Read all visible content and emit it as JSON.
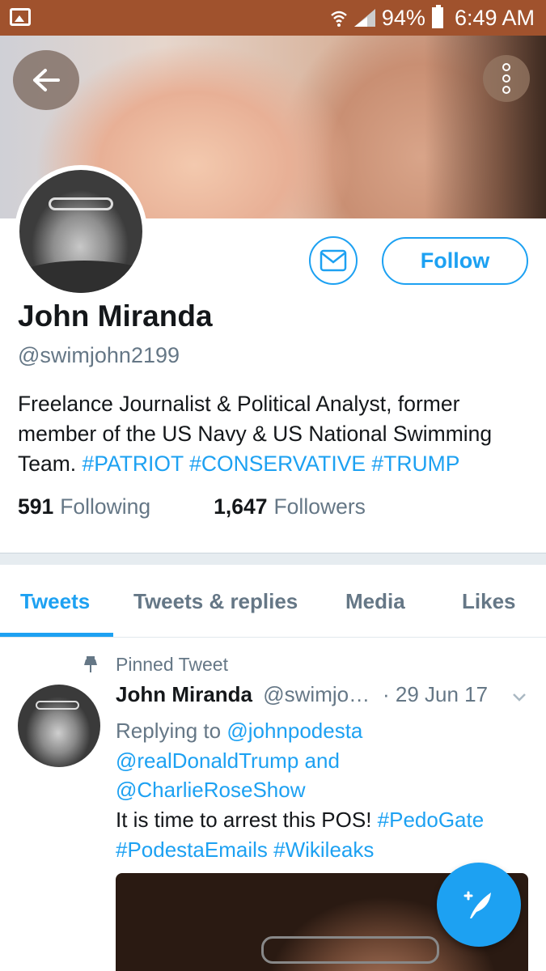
{
  "status_bar": {
    "battery": "94%",
    "time": "6:49 AM",
    "icons": [
      "gallery-icon",
      "wifi-icon",
      "signal-icon",
      "battery-icon"
    ]
  },
  "header": {
    "back_icon": "arrow-left-icon",
    "more_icon": "more-vertical-icon"
  },
  "profile": {
    "name": "John Miranda",
    "handle": "@swimjohn2199",
    "bio_text": "Freelance Journalist & Political Analyst, former member of the US Navy & US National Swimming Team.",
    "bio_hashtags": [
      "#PATRIOT",
      "#CONSERVATIVE",
      "#TRUMP"
    ],
    "following_count": "591",
    "following_label": "Following",
    "followers_count": "1,647",
    "followers_label": "Followers"
  },
  "actions": {
    "message_icon": "envelope-icon",
    "follow_label": "Follow"
  },
  "tabs": [
    {
      "label": "Tweets",
      "active": true
    },
    {
      "label": "Tweets & replies",
      "active": false
    },
    {
      "label": "Media",
      "active": false
    },
    {
      "label": "Likes",
      "active": false
    }
  ],
  "tweet": {
    "pinned_label": "Pinned Tweet",
    "author_name": "John Miranda",
    "author_handle": "@swimjo…",
    "date": "· 29 Jun 17",
    "replying_prefix": "Replying to",
    "mention_1": "@johnpodesta",
    "mention_2": "@realDonaldTrump",
    "and_word": "and",
    "mention_3": "@CharlieRoseShow",
    "text": "It is time to arrest this POS!",
    "hashtags": [
      "#PedoGate",
      "#PodestaEmails",
      "#Wikileaks"
    ]
  },
  "fab": {
    "icon": "compose-tweet-icon"
  },
  "colors": {
    "status_bar": "#a0522d",
    "accent": "#1da1f2",
    "text_primary": "#14171a",
    "text_secondary": "#657786"
  }
}
